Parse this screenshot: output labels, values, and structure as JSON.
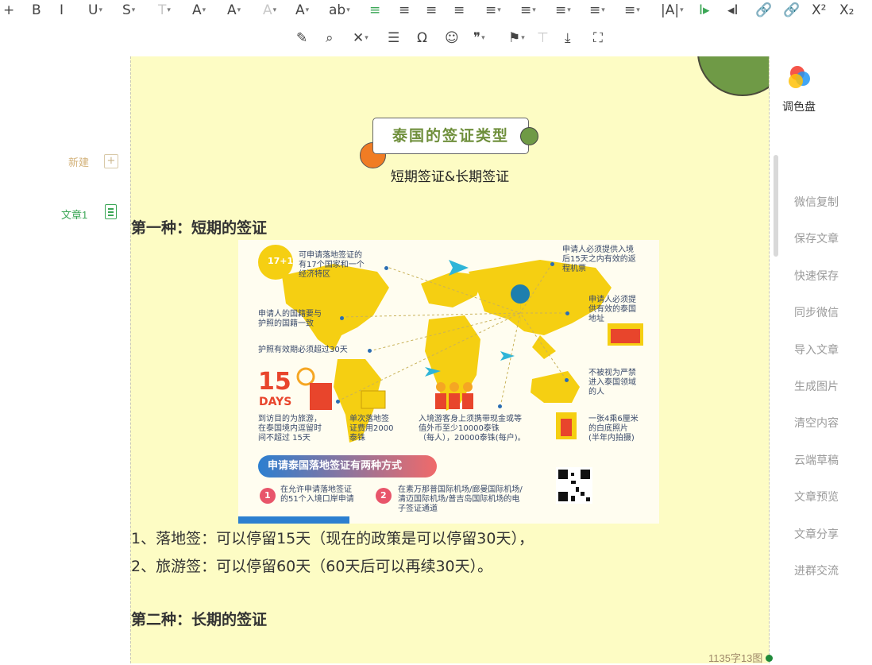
{
  "toolbar": {
    "row1": [
      {
        "name": "add-icon",
        "glyph": "+"
      },
      {
        "name": "bold-icon",
        "glyph": "B"
      },
      {
        "name": "italic-icon",
        "glyph": "I"
      },
      {
        "name": "underline-icon",
        "glyph": "U"
      },
      {
        "name": "strikethrough-icon",
        "glyph": "S"
      },
      {
        "name": "clear-format-icon",
        "glyph": "T"
      },
      {
        "name": "text-border-icon",
        "glyph": "A"
      },
      {
        "name": "font-color-icon",
        "glyph": "A"
      },
      {
        "name": "highlight-icon",
        "glyph": "A"
      },
      {
        "name": "font-size-icon",
        "glyph": "A"
      },
      {
        "name": "ab-style-icon",
        "glyph": "ab"
      },
      {
        "name": "align-left-icon",
        "glyph": "≡"
      },
      {
        "name": "align-center-icon",
        "glyph": "≡"
      },
      {
        "name": "align-right-icon",
        "glyph": "≡"
      },
      {
        "name": "align-justify-icon",
        "glyph": "≡"
      },
      {
        "name": "indent-icon",
        "glyph": "≡"
      },
      {
        "name": "line-height-icon",
        "glyph": "≡"
      },
      {
        "name": "paragraph-spacing-icon",
        "glyph": "≡"
      },
      {
        "name": "list-spacing-icon",
        "glyph": "≡"
      },
      {
        "name": "outdent-icon",
        "glyph": "≡"
      },
      {
        "name": "letter-spacing-icon",
        "glyph": "|A|"
      },
      {
        "name": "text-direction-icon",
        "glyph": "I▸"
      },
      {
        "name": "cursor-text-icon",
        "glyph": "◂I"
      },
      {
        "name": "link-icon",
        "glyph": "🔗"
      },
      {
        "name": "unlink-icon",
        "glyph": "🔗"
      },
      {
        "name": "superscript-icon",
        "glyph": "X²"
      },
      {
        "name": "subscript-icon",
        "glyph": "X₂"
      }
    ],
    "row2": [
      {
        "name": "format-brush-icon",
        "glyph": "✎"
      },
      {
        "name": "find-replace-icon",
        "glyph": "⌕"
      },
      {
        "name": "magic-clear-icon",
        "glyph": "✕"
      },
      {
        "name": "horizontal-rule-icon",
        "glyph": "☰"
      },
      {
        "name": "special-char-icon",
        "glyph": "Ω"
      },
      {
        "name": "emoji-icon",
        "glyph": "☺"
      },
      {
        "name": "quote-icon",
        "glyph": "❞"
      },
      {
        "name": "flag-icon",
        "glyph": "⚑"
      },
      {
        "name": "move-top-icon",
        "glyph": "⊤"
      },
      {
        "name": "move-bottom-icon",
        "glyph": "⤓"
      },
      {
        "name": "fullscreen-icon",
        "glyph": "⛶"
      }
    ]
  },
  "sidebar": {
    "new_label": "新建",
    "doc_label": "文章1"
  },
  "document": {
    "title_box": "泰国的签证类型",
    "subtitle": "短期签证&长期签证",
    "heading_1": "第一种：短期的签证",
    "line_1": "1、落地签：可以停留15天（现在的政策是可以停留30天），",
    "line_2": "2、旅游签：可以停留60天（60天后可以再续30天）。",
    "heading_2": "第二种：长期的签证"
  },
  "infographic": {
    "badge": "17+1",
    "note_17": "可申请落地签证的\n有17个国家和一个\n经济特区",
    "note_ticket": "申请人必须提供入境\n后15天之内有效的返\n程机票",
    "note_nationality": "申请人的国籍要与\n护照的国籍一致",
    "note_address": "申请人必须提\n供有效的泰国\n地址",
    "note_passport": "护照有效期必须超过30天",
    "note_banned": "不被视为严禁\n进入泰国领域\n的人",
    "days_num": "15",
    "days_word": "DAYS",
    "note_purpose": "到访目的为旅游，\n在泰国境内逗留时\n间不超过 15天",
    "note_fee": "单次落地签\n证费用2000\n泰铢",
    "note_cash": "入境游客身上须携带现金或等\n值外币至少10000泰铢\n（每人），20000泰铢(每户)。",
    "note_photo": "一张4乘6厘米\n的白底照片\n(半年内拍摄)",
    "banner": "申请泰国落地签证有两种方式",
    "way_1_num": "1",
    "way_1": "在允许申请落地签证\n的51个入境口岸申请",
    "way_2_num": "2",
    "way_2": "在素万那普国际机场/廊曼国际机场/\n清迈国际机场/普吉岛国际机场的电\n子签证通道"
  },
  "right_panel": {
    "palette_label": "调色盘",
    "menu": [
      "微信复制",
      "保存文章",
      "快速保存",
      "同步微信",
      "导入文章",
      "生成图片",
      "清空内容",
      "云端草稿",
      "文章预览",
      "文章分享",
      "进群交流"
    ]
  },
  "status": {
    "count": "1135字13图"
  },
  "colors": {
    "editor_bg": "#fdfcc4",
    "accent_green": "#3aa655",
    "title_green": "#6f8f3c",
    "map_yellow": "#f5cf12",
    "orange": "#f07c24"
  }
}
